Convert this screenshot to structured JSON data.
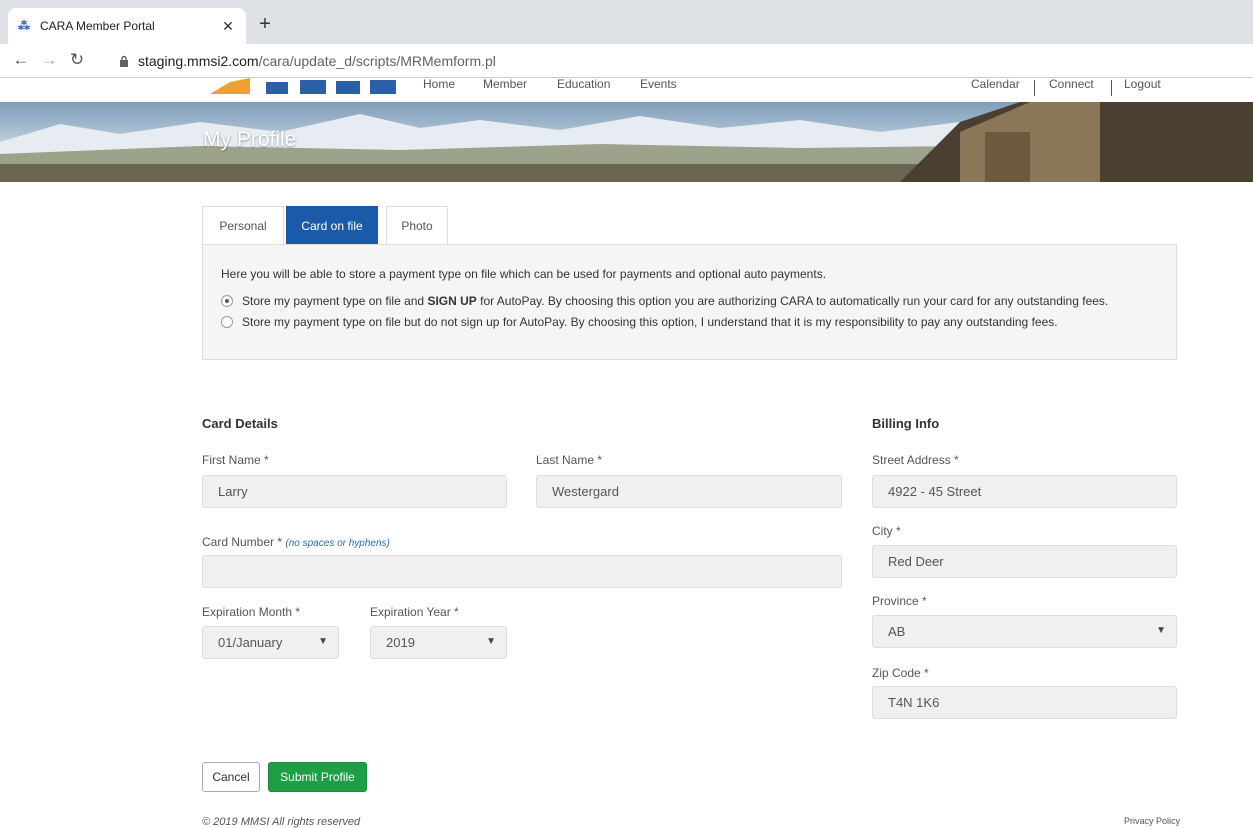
{
  "browser": {
    "tab_title": "CARA Member Portal",
    "favicon": "cara-icon",
    "url_host": "staging.mmsi2.com",
    "url_path": "/cara/update_d/scripts/MRMemform.pl"
  },
  "site_nav": {
    "left": [
      "Home",
      "Member",
      "Education",
      "Events"
    ],
    "right": [
      "Calendar",
      "Connect",
      "Logout"
    ]
  },
  "hero": {
    "title": "My Profile"
  },
  "tabs": [
    {
      "label": "Personal",
      "active": false
    },
    {
      "label": "Card on file",
      "active": true
    },
    {
      "label": "Photo",
      "active": false
    }
  ],
  "panel": {
    "intro": "Here you will be able to store a payment type on file which can be used for payments and optional auto payments.",
    "option1_pre": "Store my payment type on file and ",
    "option1_bold": "SIGN UP",
    "option1_post": " for AutoPay. By choosing this option you are authorizing CARA to automatically run your card for any outstanding fees.",
    "option2": "Store my payment type on file but do not sign up for AutoPay. By choosing this option, I understand that it is my responsibility to pay any outstanding fees.",
    "selected": 1
  },
  "card": {
    "heading": "Card Details",
    "first_name_label": "First Name *",
    "first_name": "Larry",
    "last_name_label": "Last Name *",
    "last_name": "Westergard",
    "card_number_label": "Card Number *",
    "card_number_hint": "(no spaces or hyphens)",
    "card_number": "",
    "exp_month_label": "Expiration Month *",
    "exp_month": "01/January",
    "exp_year_label": "Expiration Year *",
    "exp_year": "2019"
  },
  "billing": {
    "heading": "Billing Info",
    "street_label": "Street Address *",
    "street": "4922 - 45 Street",
    "city_label": "City *",
    "city": "Red Deer",
    "province_label": "Province *",
    "province": "AB",
    "zip_label": "Zip Code *",
    "zip": "T4N 1K6"
  },
  "buttons": {
    "cancel": "Cancel",
    "submit": "Submit Profile"
  },
  "footer": {
    "copyright": "© 2019 MMSI All rights reserved",
    "privacy": "Privacy Policy"
  },
  "colors": {
    "tab_active": "#1a5aa8",
    "submit": "#1e9e45"
  }
}
